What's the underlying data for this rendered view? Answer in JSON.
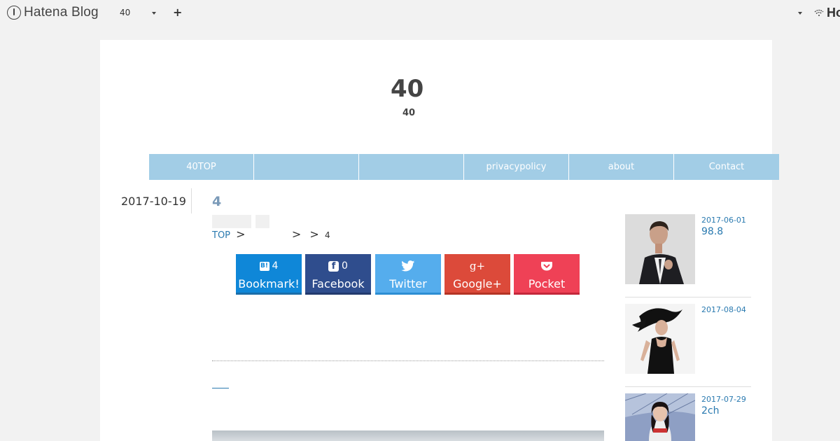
{
  "topbar": {
    "logo_text": "Hatena Blog",
    "blog_name": "40",
    "plus_label": "+",
    "right_logo": "Ho"
  },
  "header": {
    "title": "40",
    "description": "40"
  },
  "nav": {
    "items": [
      {
        "label": "40TOP"
      },
      {
        "label": ""
      },
      {
        "label": ""
      },
      {
        "label": "privacypolicy"
      },
      {
        "label": "about"
      },
      {
        "label": "Contact"
      }
    ]
  },
  "entry": {
    "date": "2017-10-19",
    "title": "4",
    "breadcrumb": {
      "top": "TOP",
      "sep": ">",
      "last": "4"
    },
    "share": {
      "hatena": {
        "count": "4",
        "label": "Bookmark!",
        "badge": "B!"
      },
      "facebook": {
        "count": "0",
        "label": "Facebook",
        "badge": "f"
      },
      "twitter": {
        "label": "Twitter"
      },
      "googleplus": {
        "label": "Google+",
        "glyph": "g+"
      },
      "pocket": {
        "label": "Pocket"
      }
    }
  },
  "sidebar": {
    "items": [
      {
        "date": "2017-06-01",
        "title": "98.8"
      },
      {
        "date": "2017-08-04",
        "title": ""
      },
      {
        "date": "2017-07-29",
        "title": "2ch"
      }
    ]
  },
  "colors": {
    "nav_bg": "#a2cde6",
    "link": "#2a7ab0",
    "hatena": "#0f87d8",
    "facebook": "#2f4d8d",
    "twitter": "#55aded",
    "googleplus": "#dc4a3a",
    "pocket": "#ef4156"
  }
}
